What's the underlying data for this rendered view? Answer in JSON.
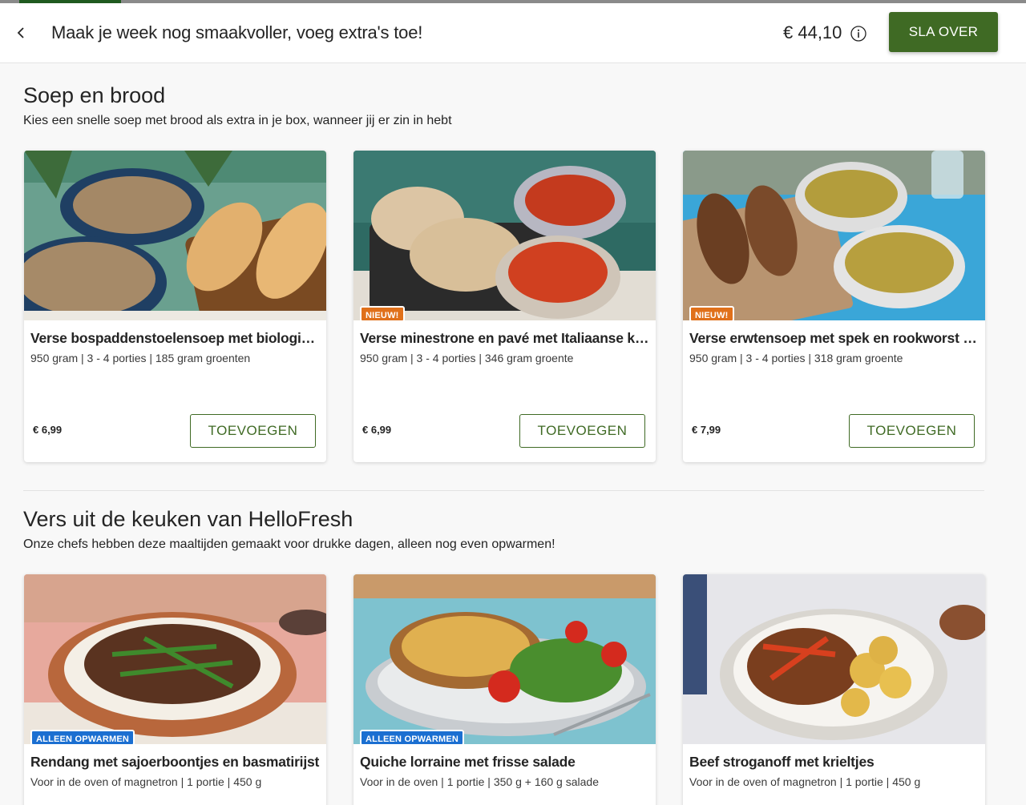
{
  "header": {
    "title": "Maak je week nog smaakvoller, voeg extra's toe!",
    "total_price": "€ 44,10",
    "skip_label": "SLA OVER"
  },
  "progress": {
    "value": 0.1
  },
  "sections": [
    {
      "title": "Soep en brood",
      "subtitle": "Kies een snelle soep met brood als extra in je box, wanneer jij er zin in hebt",
      "cards": [
        {
          "title": "Verse bospaddenstoelensoep met biologisch stokbrood",
          "desc": "950 gram | 3 - 4 porties | 185 gram groenten",
          "badge": "",
          "price": "€ 6,99",
          "button": "TOEVOEGEN"
        },
        {
          "title": "Verse minestrone en pavé met Italiaanse kruiden",
          "desc": "950 gram | 3 - 4 porties | 346 gram groente",
          "badge": "NIEUW!",
          "price": "€ 6,99",
          "button": "TOEVOEGEN"
        },
        {
          "title": "Verse erwtensoep met spek en rookworst met roggebrood",
          "desc": "950 gram | 3 - 4 porties | 318 gram groente",
          "badge": "NIEUW!",
          "price": "€ 7,99",
          "button": "TOEVOEGEN"
        }
      ]
    },
    {
      "title": "Vers uit de keuken van HelloFresh",
      "subtitle": "Onze chefs hebben deze maaltijden gemaakt voor drukke dagen, alleen nog even opwarmen!",
      "cards": [
        {
          "title": "Rendang met sajoerboontjes en basmatirijst",
          "desc": "Voor in de oven of magnetron | 1 portie | 450 g",
          "badge": "ALLEEN OPWARMEN"
        },
        {
          "title": "Quiche lorraine met frisse salade",
          "desc": "Voor in de oven | 1 portie | 350 g + 160 g salade",
          "badge": "ALLEEN OPWARMEN"
        },
        {
          "title": "Beef stroganoff met krieltjes",
          "desc": "Voor in de oven of magnetron | 1 portie | 450 g",
          "badge": ""
        }
      ]
    }
  ],
  "icons": {
    "back": "chevron-left-icon",
    "info": "info-circle-icon"
  },
  "colors": {
    "brand_green": "#3f6a24",
    "badge_new": "#e0701a",
    "badge_heat": "#1b6fd1",
    "progress": "#1f5a1f"
  }
}
